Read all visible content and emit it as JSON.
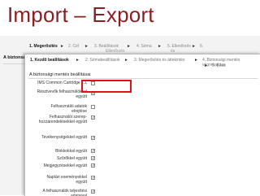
{
  "slide_title": "Import – Export",
  "background": {
    "steps": [
      {
        "label": "1. Megerősítés",
        "active": true
      },
      {
        "label": "2. Cél",
        "active": false
      },
      {
        "label": "3. Beállítások",
        "active": false
      },
      {
        "label": "4. Séma",
        "active": false
      },
      {
        "label": "5. Ellenőrzés",
        "active": false
      },
      {
        "label": "6.",
        "active": false
      }
    ],
    "step_sub": [
      "Ellenőrzés",
      "és"
    ],
    "arrow": "►",
    "heading": "A biztonsági m"
  },
  "front": {
    "steps": [
      {
        "label": "1. Kezdő beállítások",
        "active": true
      },
      {
        "label": "2. Sémabeállítások",
        "active": false
      },
      {
        "label": "3. Megerősítés és áttekintés",
        "active": false
      },
      {
        "label": "4. Biztonsági mentés végrehajtása",
        "active": false
      },
      {
        "label": "5. Kész",
        "active": false
      }
    ],
    "arrow": "►",
    "section_title": "A biztonsági mentés beállításai",
    "settings": [
      {
        "label": "IMS Common Cartridge 1.1",
        "checked": false,
        "highlighted": true
      },
      {
        "label": "Résztvevők felhasználókkal együtt",
        "checked": true
      },
      {
        "label": "Felhasználói adatok elrejtése",
        "checked": false
      },
      {
        "label": "Felhasználói szerep-hozzárendelésekkel együtt",
        "checked": true
      },
      {
        "label": "Tevékenységekkel együtt",
        "checked": true
      },
      {
        "label": "Blokkokkal együtt",
        "checked": true
      },
      {
        "label": "Szűrőkkel együtt",
        "checked": true
      },
      {
        "label": "Megjegyzésekkel együtt",
        "checked": true
      },
      {
        "label": "Naptári eseményekkel együtt",
        "checked": true
      },
      {
        "label": "A felhasználók teljesítési adataival",
        "checked": true
      }
    ]
  }
}
